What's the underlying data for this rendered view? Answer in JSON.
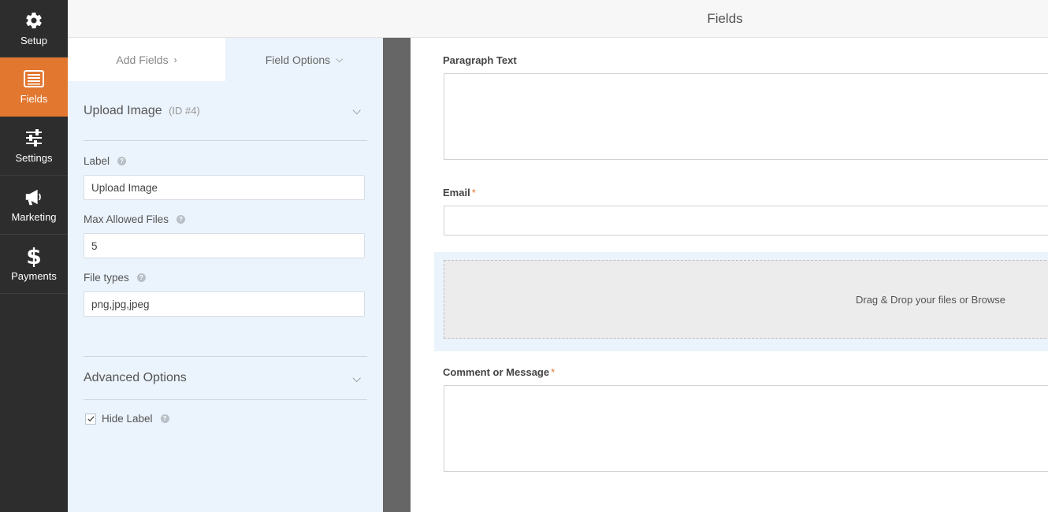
{
  "nav": {
    "items": [
      {
        "label": "Setup",
        "icon": "gear-icon"
      },
      {
        "label": "Fields",
        "icon": "fields-list-icon"
      },
      {
        "label": "Settings",
        "icon": "sliders-icon"
      },
      {
        "label": "Marketing",
        "icon": "megaphone-icon"
      },
      {
        "label": "Payments",
        "icon": "dollar-icon"
      }
    ],
    "active": "Fields"
  },
  "header": {
    "title": "Fields"
  },
  "panel": {
    "tabs": {
      "add_fields": "Add Fields",
      "field_options": "Field Options"
    },
    "field_group": {
      "title": "Upload Image",
      "id_text": "(ID #4)"
    },
    "label_field": {
      "label": "Label",
      "value": "Upload Image"
    },
    "max_files_field": {
      "label": "Max Allowed Files",
      "value": "5"
    },
    "file_types_field": {
      "label": "File types",
      "value": "png,jpg,jpeg"
    },
    "advanced": {
      "title": "Advanced Options"
    },
    "hide_label": {
      "label": "Hide Label",
      "checked": true
    }
  },
  "preview": {
    "paragraph": {
      "label": "Paragraph Text"
    },
    "email": {
      "label": "Email",
      "required_mark": "*"
    },
    "upload": {
      "text": "Drag & Drop your files or Browse"
    },
    "comment": {
      "label": "Comment or Message",
      "required_mark": "*"
    }
  },
  "colors": {
    "accent": "#e27730",
    "nav_bg": "#2d2d2d",
    "panel_bg": "#ebf3fc"
  }
}
